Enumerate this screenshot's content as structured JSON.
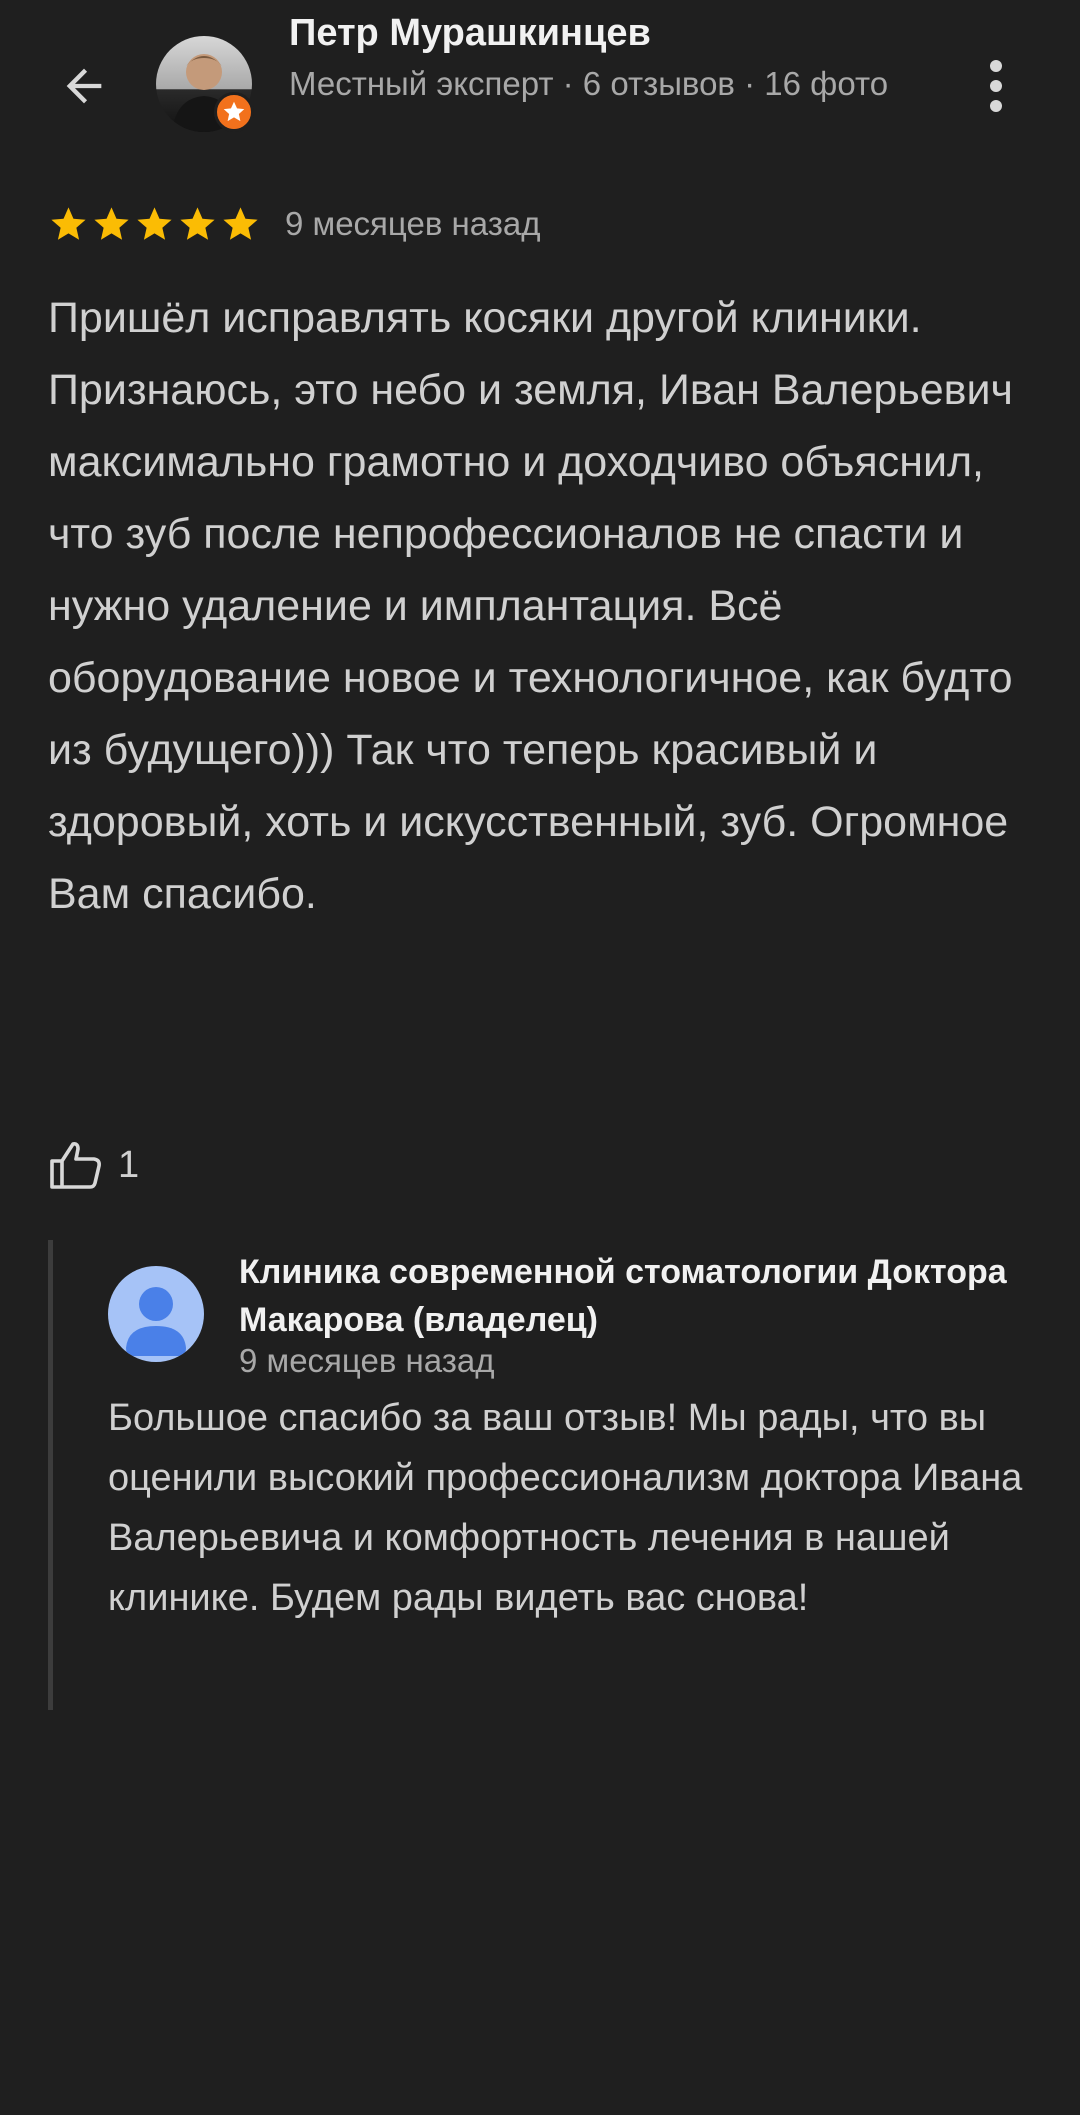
{
  "header": {
    "author_name": "Петр Мурашкинцев",
    "author_meta": "Местный эксперт · 6 отзывов · 16 фото",
    "back_icon": "arrow-left-icon",
    "menu_icon": "more-vert-icon",
    "badge_icon": "local-guide-star-icon"
  },
  "review": {
    "rating": 5,
    "rating_max": 5,
    "date": "9 месяцев назад",
    "text": "Пришёл исправлять косяки другой клиники. Признаюсь, это небо и земля, Иван Валерьевич максимально грамотно и доходчиво объяснил, что зуб после непрофессионалов не спасти и нужно удаление и имплантация. Всё оборудование новое и технологичное, как будто из будущего))) Так что теперь красивый и здоровый, хоть и искусственный, зуб. Огромное Вам спасибо.",
    "like_icon": "thumbs-up-icon",
    "like_count": "1"
  },
  "owner_reply": {
    "name": "Клиника современной стоматологии Доктора Макарова (владелец)",
    "date": "9 месяцев назад",
    "text": "Большое спасибо за ваш отзыв! Мы рады, что вы оценили высокий профессионализм доктора Ивана Валерьевича и комфортность лечения в нашей клинике. Будем рады видеть вас снова!",
    "avatar_icon": "default-person-avatar-icon"
  },
  "colors": {
    "background": "#1f1f1f",
    "star": "#fbbc04",
    "badge": "#f2711c",
    "owner_avatar_bg": "#a6c3f7",
    "owner_avatar_fg": "#4a80e8"
  }
}
